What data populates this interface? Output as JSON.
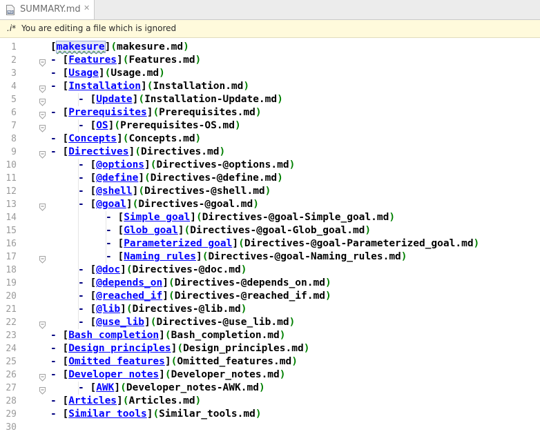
{
  "tab": {
    "filename": "SUMMARY.md",
    "icon": "markdown-file-icon",
    "close_icon": "close-icon"
  },
  "notice": {
    "icon_text": ".i*",
    "text": "You are editing a file which is ignored"
  },
  "colors": {
    "link_text": "#0000ff",
    "url": "#000000",
    "paren": "#008000",
    "dash": "#000080",
    "line_number": "#9a9a9a",
    "notice_bg": "#fffadc"
  },
  "lines": [
    {
      "n": "1",
      "indent": 0,
      "bullet": false,
      "text": "makesure",
      "url": "makesure.md",
      "fold": false
    },
    {
      "n": "2",
      "indent": 0,
      "bullet": true,
      "text": "Features",
      "url": "Features.md",
      "fold": true
    },
    {
      "n": "3",
      "indent": 0,
      "bullet": true,
      "text": "Usage",
      "url": "Usage.md",
      "fold": false
    },
    {
      "n": "4",
      "indent": 0,
      "bullet": true,
      "text": "Installation",
      "url": "Installation.md",
      "fold": true
    },
    {
      "n": "5",
      "indent": 1,
      "bullet": true,
      "text": "Update",
      "url": "Installation-Update.md",
      "fold": true
    },
    {
      "n": "6",
      "indent": 0,
      "bullet": true,
      "text": "Prerequisites",
      "url": "Prerequisites.md",
      "fold": true
    },
    {
      "n": "7",
      "indent": 1,
      "bullet": true,
      "text": "OS",
      "url": "Prerequisites-OS.md",
      "fold": true
    },
    {
      "n": "8",
      "indent": 0,
      "bullet": true,
      "text": "Concepts",
      "url": "Concepts.md",
      "fold": false
    },
    {
      "n": "9",
      "indent": 0,
      "bullet": true,
      "text": "Directives",
      "url": "Directives.md",
      "fold": true
    },
    {
      "n": "10",
      "indent": 1,
      "bullet": true,
      "text": "@options",
      "url": "Directives-@options.md",
      "fold": false
    },
    {
      "n": "11",
      "indent": 1,
      "bullet": true,
      "text": "@define",
      "url": "Directives-@define.md",
      "fold": false
    },
    {
      "n": "12",
      "indent": 1,
      "bullet": true,
      "text": "@shell",
      "url": "Directives-@shell.md",
      "fold": false
    },
    {
      "n": "13",
      "indent": 1,
      "bullet": true,
      "text": "@goal",
      "url": "Directives-@goal.md",
      "fold": true
    },
    {
      "n": "14",
      "indent": 2,
      "bullet": true,
      "text": "Simple goal",
      "url": "Directives-@goal-Simple_goal.md",
      "fold": false
    },
    {
      "n": "15",
      "indent": 2,
      "bullet": true,
      "text": "Glob goal",
      "url": "Directives-@goal-Glob_goal.md",
      "fold": false
    },
    {
      "n": "16",
      "indent": 2,
      "bullet": true,
      "text": "Parameterized goal",
      "url": "Directives-@goal-Parameterized_goal.md",
      "fold": false
    },
    {
      "n": "17",
      "indent": 2,
      "bullet": true,
      "text": "Naming rules",
      "url": "Directives-@goal-Naming_rules.md",
      "fold": true
    },
    {
      "n": "18",
      "indent": 1,
      "bullet": true,
      "text": "@doc",
      "url": "Directives-@doc.md",
      "fold": false
    },
    {
      "n": "19",
      "indent": 1,
      "bullet": true,
      "text": "@depends_on",
      "url": "Directives-@depends_on.md",
      "fold": false
    },
    {
      "n": "20",
      "indent": 1,
      "bullet": true,
      "text": "@reached_if",
      "url": "Directives-@reached_if.md",
      "fold": false
    },
    {
      "n": "21",
      "indent": 1,
      "bullet": true,
      "text": "@lib",
      "url": "Directives-@lib.md",
      "fold": false
    },
    {
      "n": "22",
      "indent": 1,
      "bullet": true,
      "text": "@use_lib",
      "url": "Directives-@use_lib.md",
      "fold": true
    },
    {
      "n": "23",
      "indent": 0,
      "bullet": true,
      "text": "Bash completion",
      "url": "Bash_completion.md",
      "fold": false
    },
    {
      "n": "24",
      "indent": 0,
      "bullet": true,
      "text": "Design principles",
      "url": "Design_principles.md",
      "fold": false
    },
    {
      "n": "25",
      "indent": 0,
      "bullet": true,
      "text": "Omitted features",
      "url": "Omitted_features.md",
      "fold": false
    },
    {
      "n": "26",
      "indent": 0,
      "bullet": true,
      "text": "Developer notes",
      "url": "Developer_notes.md",
      "fold": true
    },
    {
      "n": "27",
      "indent": 1,
      "bullet": true,
      "text": "AWK",
      "url": "Developer_notes-AWK.md",
      "fold": true
    },
    {
      "n": "28",
      "indent": 0,
      "bullet": true,
      "text": "Articles",
      "url": "Articles.md",
      "fold": false
    },
    {
      "n": "29",
      "indent": 0,
      "bullet": true,
      "text": "Similar tools",
      "url": "Similar_tools.md",
      "fold": false
    },
    {
      "n": "30",
      "indent": 0,
      "bullet": false,
      "text": "",
      "url": "",
      "fold": false
    }
  ]
}
